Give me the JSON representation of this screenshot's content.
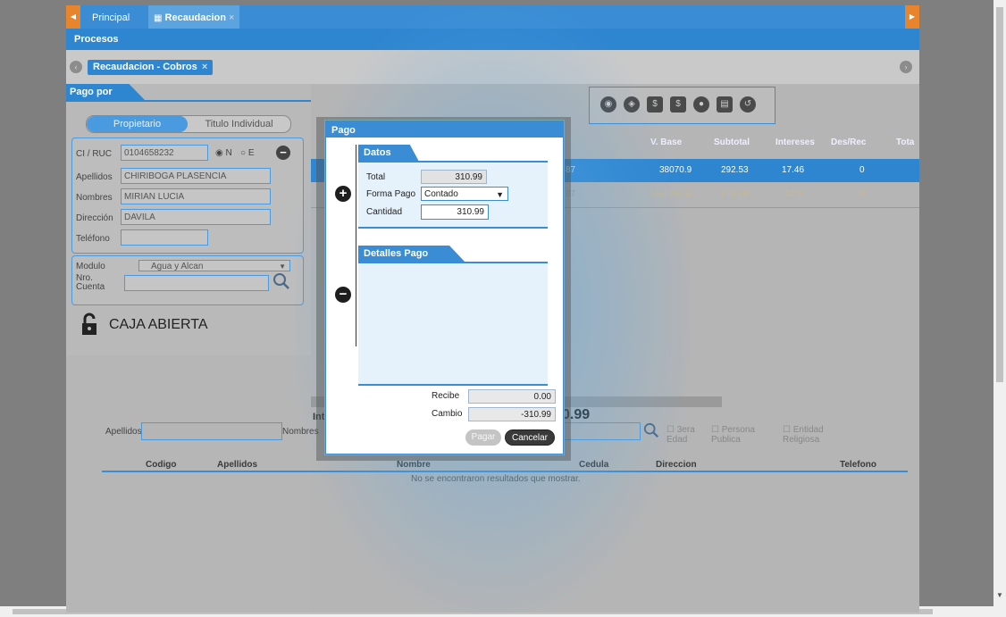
{
  "tabs": {
    "principal": "Principal",
    "recaudacion": "Recaudacion",
    "close": "×"
  },
  "procesos": "Procesos",
  "subtab": {
    "label": "Recaudacion - Cobros",
    "close": "×"
  },
  "left": {
    "pago_por": "Pago por",
    "toggle": {
      "on": "Propietario",
      "off": "Titulo Individual"
    },
    "ci_label": "CI / RUC",
    "ci_value": "0104658232",
    "radio_n": "N",
    "radio_e": "E",
    "apellidos_label": "Apellidos",
    "apellidos_value": "CHIRIBOGA PLASENCIA",
    "nombres_label": "Nombres",
    "nombres_value": "MIRIAN LUCIA",
    "direccion_label": "Dirección",
    "direccion_value": "DAVILA",
    "telefono_label": "Teléfono",
    "telefono_value": "",
    "modulo_label": "Modulo",
    "modulo_value": "Agua y Alcan",
    "nro_cuenta_label": "Nro. Cuenta",
    "caja_status": "CAJA ABIERTA"
  },
  "grid": {
    "headers": [
      "V. Base",
      "Subtotal",
      "Intereses",
      "Des/Rec",
      "Tota"
    ],
    "rows": [
      {
        "frag": "87",
        "vbase": "38070.9",
        "subtotal": "292.53",
        "intereses": "17.46",
        "desrec": "0"
      },
      {
        "frag": "87",
        "vbase": "144173.14",
        "subtotal": "216.28",
        "intereses": "12.9",
        "desrec": "0"
      }
    ],
    "total_prefix": "Int",
    "total_suffix": "0.99"
  },
  "search": {
    "apellidos_label": "Apellidos",
    "nombres_label": "Nombres",
    "checks": [
      "3era Edad",
      "Persona Publica",
      "Entidad Religiosa"
    ],
    "columns": [
      "Codigo",
      "Apellidos",
      "Nombre",
      "Cedula",
      "Direccion",
      "Telefono"
    ],
    "empty_message": "No se encontraron resultados que mostrar."
  },
  "modal": {
    "title": "Pago",
    "datos_header": "Datos",
    "total_label": "Total",
    "total_value": "310.99",
    "forma_pago_label": "Forma Pago",
    "forma_pago_value": "Contado",
    "cantidad_label": "Cantidad",
    "cantidad_value": "310.99",
    "detalles_header": "Detalles Pago",
    "recibe_label": "Recibe",
    "recibe_value": "0.00",
    "cambio_label": "Cambio",
    "cambio_value": "-310.99",
    "pagar_label": "Pagar",
    "cancelar_label": "Cancelar"
  },
  "colors": {
    "accent": "#3a8dd4",
    "overlay_gray": "#7f7f7f"
  }
}
